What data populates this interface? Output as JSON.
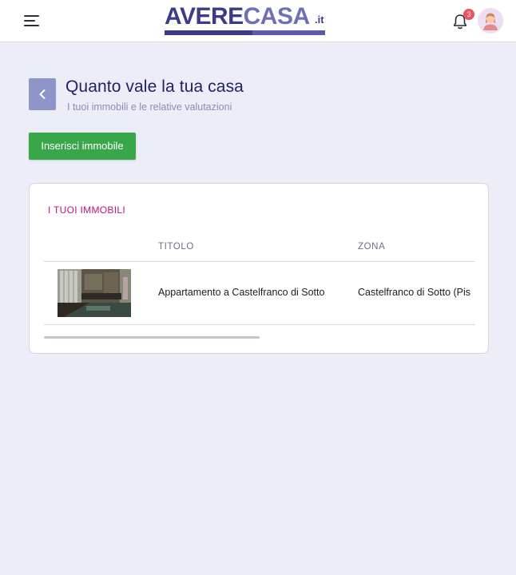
{
  "header": {
    "logo_word_a": "AVERE",
    "logo_word_b": "CASA",
    "logo_tld": ".it",
    "notifications_count": "3"
  },
  "page": {
    "title": "Quanto vale la tua casa",
    "subtitle": "I tuoi immobili e le relative valutazioni",
    "add_button_label": "Inserisci immobile"
  },
  "card": {
    "title": "I TUOI IMMOBILI",
    "columns": [
      "",
      "TITOLO",
      "ZONA"
    ],
    "rows": [
      {
        "image": "kitchen-photo",
        "titolo": "Appartamento a Castelfranco di Sotto",
        "zona": "Castelfranco di Sotto (Pis"
      }
    ]
  },
  "colors": {
    "brand": "#3b3c85",
    "accent_green": "#3aa64a",
    "section_title": "#c2127a",
    "back_button": "#8e96c9"
  },
  "icons": [
    "menu-icon",
    "bell-icon",
    "avatar-icon",
    "chevron-left-icon"
  ]
}
